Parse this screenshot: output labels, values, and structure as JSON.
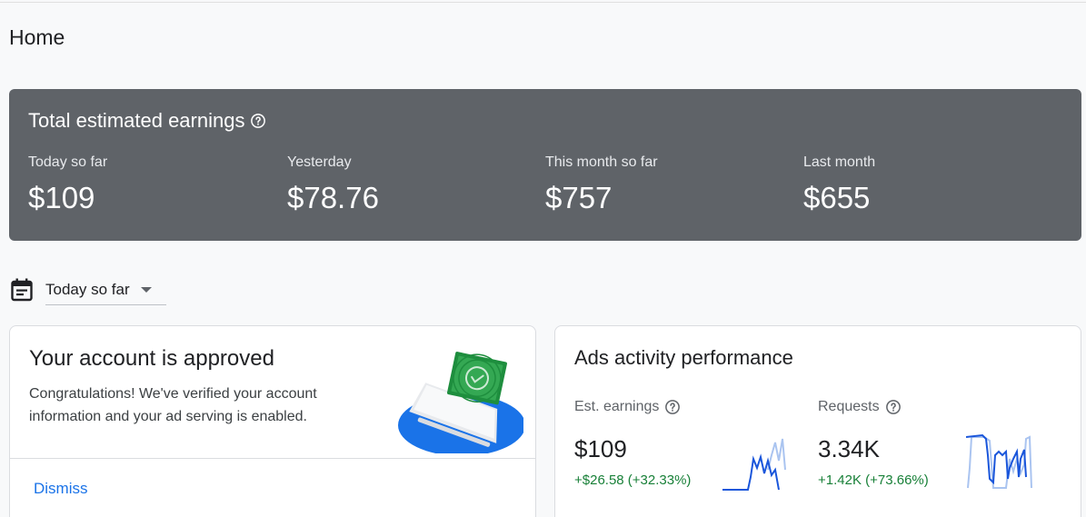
{
  "page": {
    "title": "Home"
  },
  "earnings": {
    "title": "Total estimated earnings",
    "metrics": [
      {
        "label": "Today so far",
        "value": "$109"
      },
      {
        "label": "Yesterday",
        "value": "$78.76"
      },
      {
        "label": "This month so far",
        "value": "$757"
      },
      {
        "label": "Last month",
        "value": "$655"
      }
    ]
  },
  "date_selector": {
    "value": "Today so far"
  },
  "approved_card": {
    "title": "Your account is approved",
    "description": "Congratulations! We've verified your account information and your ad serving is enabled.",
    "dismiss_label": "Dismiss"
  },
  "ads_card": {
    "title": "Ads activity performance",
    "stats": [
      {
        "label": "Est. earnings",
        "value": "$109",
        "delta": "+$26.58 (+32.33%)"
      },
      {
        "label": "Requests",
        "value": "3.34K",
        "delta": "+1.42K (+73.66%)"
      }
    ]
  },
  "colors": {
    "banner": "#5f6368",
    "link": "#1a73e8",
    "positive": "#188038",
    "spark_primary": "#1a56db",
    "spark_secondary": "#aac4f0"
  }
}
